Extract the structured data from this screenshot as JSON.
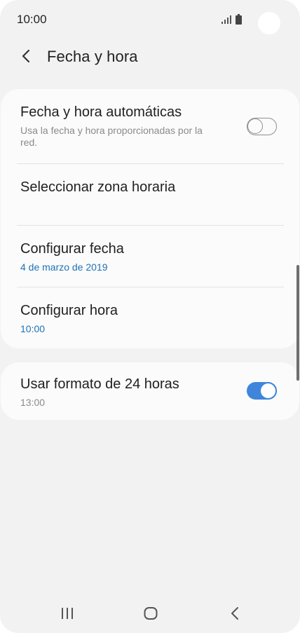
{
  "status_bar": {
    "time": "10:00"
  },
  "header": {
    "title": "Fecha y hora"
  },
  "settings": {
    "auto_datetime": {
      "title": "Fecha y hora automáticas",
      "subtitle_line1": "Usa la fecha y hora proporcionadas por la",
      "subtitle_line2": "red.",
      "enabled": false
    },
    "timezone": {
      "title": "Seleccionar zona horaria"
    },
    "set_date": {
      "title": "Configurar fecha",
      "value": "4 de marzo de 2019"
    },
    "set_time": {
      "title": "Configurar hora",
      "value": "10:00"
    },
    "format_24h": {
      "title": "Usar formato de 24 horas",
      "subtitle": "13:00",
      "enabled": true
    }
  },
  "colors": {
    "accent": "#3f85db",
    "link_blue": "#1d72b8",
    "background": "#f2f2f2",
    "card": "#fbfbfb"
  },
  "icons": {
    "back": "chevron-left-icon",
    "signal": "signal-icon",
    "battery": "battery-icon",
    "nav_recents": "recents-icon",
    "nav_home": "home-icon",
    "nav_back": "nav-back-icon"
  }
}
